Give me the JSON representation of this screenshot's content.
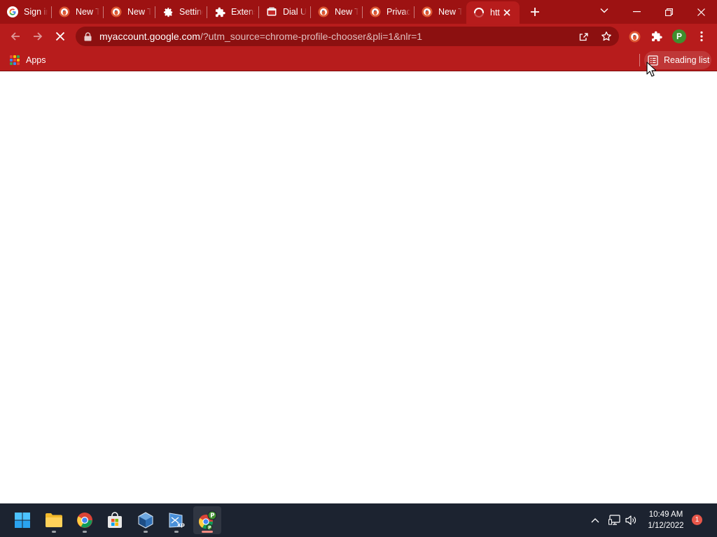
{
  "tabs": [
    {
      "title": "Sign in",
      "icon": "google-g-icon"
    },
    {
      "title": "New Tab",
      "icon": "duckduckgo-icon"
    },
    {
      "title": "New Tab",
      "icon": "duckduckgo-icon"
    },
    {
      "title": "Settings",
      "icon": "gear-icon"
    },
    {
      "title": "Extensions",
      "icon": "puzzle-icon"
    },
    {
      "title": "Dial Up",
      "icon": "dial-icon"
    },
    {
      "title": "New Tab",
      "icon": "duckduckgo-icon"
    },
    {
      "title": "Privacy",
      "icon": "duckduckgo-icon"
    },
    {
      "title": "New Tab",
      "icon": "duckduckgo-icon"
    },
    {
      "title": "htt",
      "icon": "loading-spinner-icon",
      "active": true
    }
  ],
  "omnibox": {
    "domain": "myaccount.google.com",
    "path": "/?utm_source=chrome-profile-chooser&pli=1&nlr=1"
  },
  "profile": {
    "initial": "P",
    "color": "#3f8f2e"
  },
  "bookmarks": {
    "apps_label": "Apps",
    "reading_list_label": "Reading list"
  },
  "taskbar": {
    "time": "10:49 AM",
    "date": "1/12/2022",
    "notification_count": "1"
  },
  "colors": {
    "theme": "#b71c1c",
    "titlebar": "#9d1212",
    "taskbar": "#1c2330"
  }
}
